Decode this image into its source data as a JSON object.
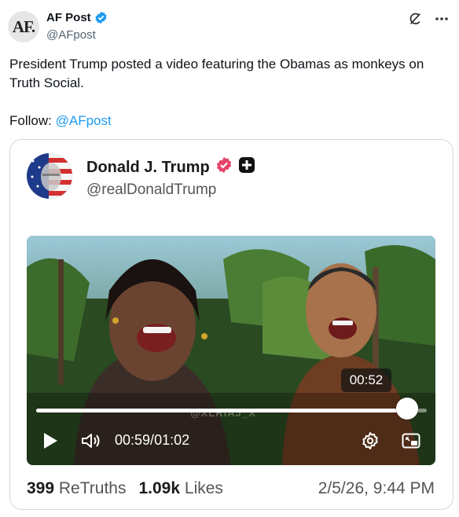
{
  "post": {
    "avatar_text": "AF.",
    "author_name": "AF Post",
    "author_handle": "@AFpost",
    "text": "President Trump posted a video featuring the Obamas as monkeys on Truth Social.",
    "follow_label": "Follow:",
    "follow_handle": "@AFpost"
  },
  "embed": {
    "name": "Donald J. Trump",
    "handle": "@realDonaldTrump",
    "video": {
      "watermark": "@XLRIAJ_X",
      "hover_time": "00:52",
      "current_time": "00:59",
      "separator": "/",
      "duration": "01:02",
      "progress": 0.95
    },
    "retruths_count": "399",
    "retruths_label": "ReTruths",
    "likes_count": "1.09k",
    "likes_label": "Likes",
    "date": "2/5/26, 9:44 PM"
  },
  "colors": {
    "verified_blue": "#1d9bf0",
    "truth_badge": "#e5436a",
    "link": "#1d9bf0"
  },
  "icons": {
    "verified": "verified-badge-icon",
    "grok": "grok-icon",
    "more": "more-icon",
    "play": "play-icon",
    "volume": "volume-icon",
    "settings": "gear-icon",
    "pip": "picture-in-picture-icon"
  }
}
